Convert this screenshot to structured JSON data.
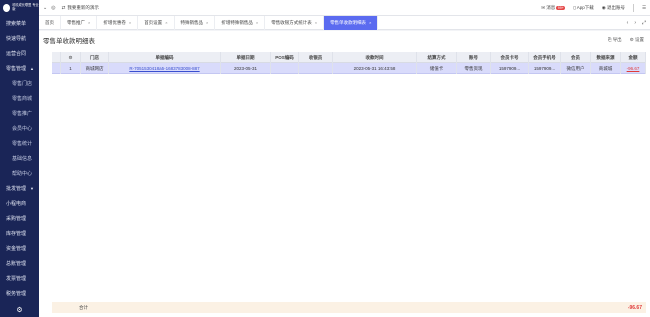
{
  "sidebar": {
    "logo_text": "嘻嘻成长联盟 专业版",
    "items": [
      {
        "label": "搜索菜单"
      },
      {
        "label": "快速导航"
      },
      {
        "label": "运营合同"
      },
      {
        "label": "零售管理"
      },
      {
        "label": "零售门店"
      },
      {
        "label": "零售商城"
      },
      {
        "label": "零售推广"
      },
      {
        "label": "会员中心"
      },
      {
        "label": "零售统计"
      },
      {
        "label": "基础信息"
      },
      {
        "label": "帮助中心"
      },
      {
        "label": "批发管理"
      },
      {
        "label": "小程电商"
      },
      {
        "label": "采购管理"
      },
      {
        "label": "库存管理"
      },
      {
        "label": "资金管理"
      },
      {
        "label": "总账管理"
      },
      {
        "label": "发票管理"
      },
      {
        "label": "税务管理"
      }
    ]
  },
  "topbar": {
    "store_label": "我要重新的演示",
    "msg_label": "消息",
    "msg_badge": "99+",
    "app_label": "App下载",
    "exit_label": "退出账号"
  },
  "tabs": [
    {
      "label": "首页",
      "closable": false,
      "active": false
    },
    {
      "label": "零售推广",
      "closable": true,
      "active": false
    },
    {
      "label": "折增优惠卷",
      "closable": true,
      "active": false
    },
    {
      "label": "首页设置",
      "closable": true,
      "active": false
    },
    {
      "label": "特殊销售品",
      "closable": true,
      "active": false
    },
    {
      "label": "折增特殊销售品",
      "closable": true,
      "active": false
    },
    {
      "label": "零售收银方式统计表",
      "closable": true,
      "active": false
    },
    {
      "label": "零售单收款明细表",
      "closable": true,
      "active": true
    }
  ],
  "page": {
    "title": "零售单收款明细表",
    "export_label": "导出",
    "settings_label": "设置"
  },
  "table": {
    "headers": [
      "",
      "门店",
      "单据编码",
      "单据日期",
      "POS编码",
      "收银员",
      "收款时间",
      "结算方式",
      "账号",
      "会员卡号",
      "会员手机号",
      "会员",
      "数据来源",
      "金额"
    ],
    "rows": [
      {
        "index": "1",
        "store": "商城网店",
        "code": "R-7051530418a5-1683783008-887",
        "date": "2023-05-31",
        "pos": "",
        "cashier": "",
        "time": "2023-05-31 16:43:58",
        "method": "储值卡",
        "account": "零售资现",
        "card": "1597909...",
        "phone": "1597909...",
        "member": "微信用户",
        "source": "商城城",
        "amount": "-96.67"
      }
    ]
  },
  "totals": {
    "label": "合计",
    "amount": "-96.67"
  }
}
